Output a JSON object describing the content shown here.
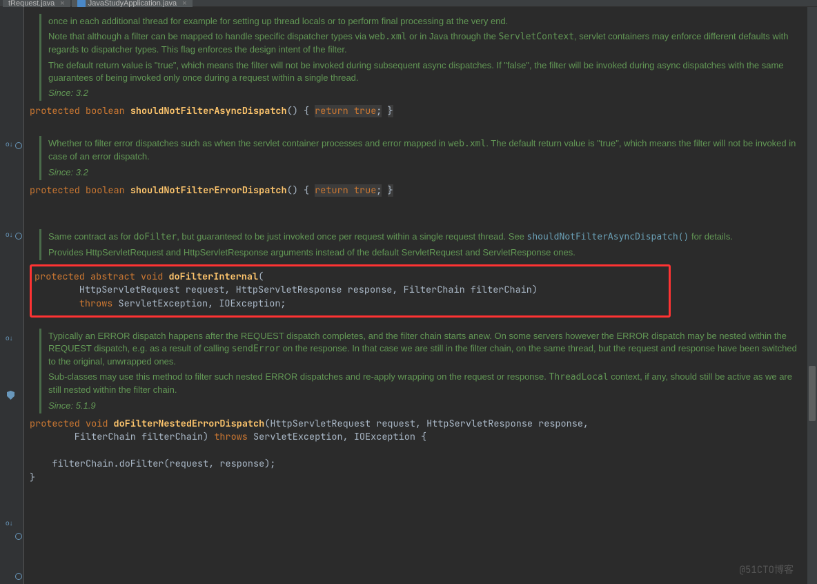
{
  "tabs": [
    {
      "label": "tRequest.java"
    },
    {
      "label": "JavaStudyApplication.java"
    }
  ],
  "doc1": {
    "p1": "once in each additional thread for example for setting up thread locals or to perform final processing at the very end.",
    "p2a": "Note that although a filter can be mapped to handle specific dispatcher types via ",
    "p2b": "web.xml",
    "p2c": " or in Java through the ",
    "p2d": "ServletContext",
    "p2e": ", servlet containers may enforce different defaults with regards to dispatcher types. This flag enforces the design intent of the filter.",
    "p3": "The default return value is \"true\", which means the filter will not be invoked during subsequent async dispatches. If \"false\", the filter will be invoked during async dispatches with the same guarantees of being invoked only once during a request within a single thread.",
    "since": "Since:  3.2"
  },
  "sig1": {
    "kw1": "protected",
    "kw2": "boolean",
    "name": "shouldNotFilterAsyncDispatch",
    "ret": "return",
    "val": "true"
  },
  "doc2": {
    "p1a": "Whether to filter error dispatches such as when the servlet container processes and error mapped in ",
    "p1b": "web.xml",
    "p1c": ". The default return value is \"true\", which means the filter will not be invoked in case of an error dispatch.",
    "since": "Since:  3.2"
  },
  "sig2": {
    "kw1": "protected",
    "kw2": "boolean",
    "name": "shouldNotFilterErrorDispatch",
    "ret": "return",
    "val": "true"
  },
  "doc3": {
    "p1a": "Same contract as for ",
    "p1b": "doFilter",
    "p1c": ", but guaranteed to be just invoked once per request within a single request thread. See ",
    "p1d": "shouldNotFilterAsyncDispatch()",
    "p1e": " for details.",
    "p2": "Provides HttpServletRequest and HttpServletResponse arguments instead of the default ServletRequest and ServletResponse ones."
  },
  "sig3": {
    "kw1": "protected",
    "kw2": "abstract",
    "kw3": "void",
    "name": "doFilterInternal",
    "l2": "        HttpServletRequest request, HttpServletResponse response, FilterChain filterChain)",
    "kw4": "throws",
    "l3": " ServletException, IOException;"
  },
  "doc4": {
    "p1a": "Typically an ERROR dispatch happens after the REQUEST dispatch completes, and the filter chain starts anew. On some servers however the ERROR dispatch may be nested within the REQUEST dispatch, e.g. as a result of calling ",
    "p1b": "sendError",
    "p1c": " on the response. In that case we are still in the filter chain, on the same thread, but the request and response have been switched to the original, unwrapped ones.",
    "p2a": "Sub-classes may use this method to filter such nested ERROR dispatches and re-apply wrapping on the request or response. ",
    "p2b": "ThreadLocal",
    "p2c": " context, if any, should still be active as we are still nested within the filter chain.",
    "since": "Since:  5.1.9"
  },
  "sig4": {
    "kw1": "protected",
    "kw2": "void",
    "name": "doFilterNestedErrorDispatch",
    "params1": "(HttpServletRequest request, HttpServletResponse response,",
    "l2a": "        FilterChain filterChain) ",
    "kw3": "throws",
    "l2b": " ServletException, IOException {",
    "body": "    filterChain.doFilter(request, response);",
    "close": "}"
  },
  "watermark": "@51CTO博客"
}
